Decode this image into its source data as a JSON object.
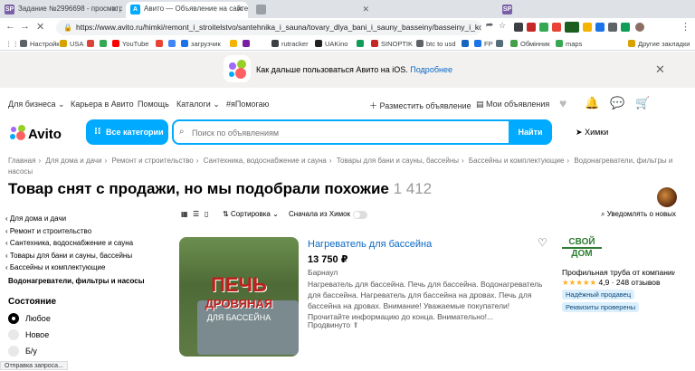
{
  "browser": {
    "tabs": [
      {
        "title": "Задание №2996698 - просмотр",
        "favicon_text": "SP"
      },
      {
        "title": "Авито — Объявление на сайте А",
        "favicon_text": "A"
      },
      {
        "title": "",
        "favicon_text": ""
      },
      {
        "title": "",
        "favicon_text": "SP"
      }
    ],
    "url": "https://www.avito.ru/himki/remont_i_stroitelstvo/santehnika_i_sauna/tovary_dlya_bani_i_sauny_basseiny/basseiny_i_komplektuyushi...",
    "bookmarks": [
      {
        "label": "Настройки",
        "color": "#5f6368"
      },
      {
        "label": "USA",
        "color": "#d7a200"
      },
      {
        "label": "",
        "color": "#db4437"
      },
      {
        "label": "",
        "color": "#34a853"
      },
      {
        "label": "YouTube",
        "color": "#ff0000"
      },
      {
        "label": "",
        "color": "#ea4335"
      },
      {
        "label": "",
        "color": "#4285f4"
      },
      {
        "label": "загрузчик",
        "color": "#1a73e8"
      },
      {
        "label": "",
        "color": "#f4b400"
      },
      {
        "label": "",
        "color": "#7b1fa2"
      },
      {
        "label": "rutracker",
        "color": "#3c4043"
      },
      {
        "label": "UAKino",
        "color": "#222"
      },
      {
        "label": "",
        "color": "#0f9d58"
      },
      {
        "label": "SINOPTIK",
        "color": "#c62828"
      },
      {
        "label": "btc to usd",
        "color": "#5f6368"
      },
      {
        "label": "",
        "color": "#1565c0"
      },
      {
        "label": "FP",
        "color": "#1a73e8"
      },
      {
        "label": "",
        "color": "#546e7a"
      },
      {
        "label": "Обмінник",
        "color": "#43a047"
      },
      {
        "label": "maps",
        "color": "#34a853"
      }
    ],
    "other_bookmarks": "Другие закладки",
    "status_text": "Отправка запроса..."
  },
  "banner": {
    "text": "Как дальше пользоваться Авито на iOS.",
    "link": "Подробнее"
  },
  "topnav": {
    "items": [
      "Для бизнеса",
      "Карьера в Авито",
      "Помощь",
      "Каталоги",
      "#яПомогаю"
    ],
    "post_ad": "Разместить объявление",
    "my_ads": "Мои объявления"
  },
  "header": {
    "brand": "Avito",
    "categories_button": "Все категории",
    "search_placeholder": "Поиск по объявлениям",
    "search_button": "Найти",
    "city": "Химки"
  },
  "breadcrumbs": [
    "Главная",
    "Для дома и дачи",
    "Ремонт и строительство",
    "Сантехника, водоснабжение и сауна",
    "Товары для бани и сауны, бассейны",
    "Бассейны и комплектующие",
    "Водонагреватели, фильтры и насосы"
  ],
  "page": {
    "title": "Товар снят с продажи, но мы подобрали похожие",
    "count": "1 412"
  },
  "sidebar": {
    "links": [
      "Для дома и дачи",
      "Ремонт и строительство",
      "Сантехника, водоснабжение и сауна",
      "Товары для бани и сауны, бассейны",
      "Бассейны и комплектующие"
    ],
    "current": "Водонагреватели, фильтры и насосы",
    "condition_title": "Состояние",
    "conditions": [
      "Любое",
      "Новое",
      "Б/у"
    ],
    "selected_condition": "Любое"
  },
  "toolbar": {
    "sort": "Сортировка",
    "nearby": "Сначала из Химок",
    "notify": "Уведомлять о новых"
  },
  "listing": {
    "title": "Нагреватель для бассейна",
    "price": "13 750 ₽",
    "location": "Барнаул",
    "description": "Нагреватель для бассейна. Печь для бассейна. Водонагреватель для бассейна. Нагреватель для бассейна на дровах. Печь для бассейна на дровах. Внимание! Уважаемые покупатели! Прочитайте информацию до конца. Внимательно!...",
    "promo": "Продвинуто",
    "photo_text_1": "ПЕЧЬ",
    "photo_text_2": "ДРОВЯНАЯ",
    "photo_text_3": "ДЛЯ БАССЕЙНА"
  },
  "seller": {
    "logo_line1": "СВОЙ",
    "logo_line2": "ДОМ",
    "name": "Профильная труба от компании",
    "rating": "4,9",
    "stars": 5,
    "reviews": "248 отзывов",
    "badges": [
      "Надёжный продавец",
      "Реквизиты проверены"
    ]
  },
  "colors": {
    "accent": "#00aaff",
    "link": "#0a69c4",
    "stars": "#ffb021"
  }
}
